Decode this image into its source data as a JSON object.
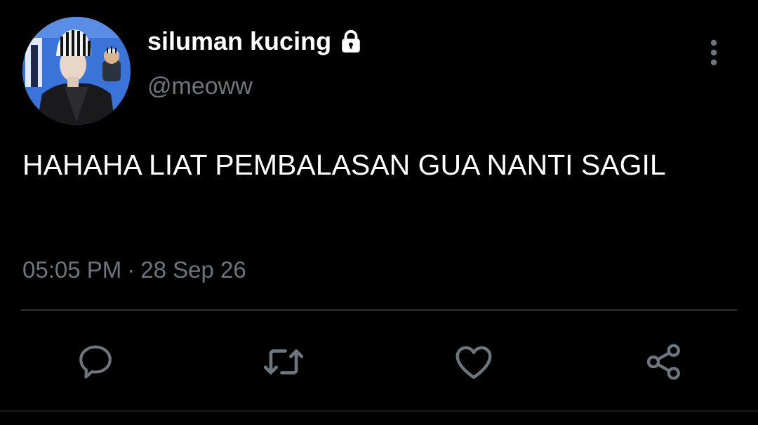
{
  "tweet": {
    "display_name": "siluman kucing",
    "protected_icon": "lock-icon",
    "handle": "@meoww",
    "text": "HAHAHA LIAT PEMBALASAN GUA NANTI SAGIL",
    "time": "05:05 PM",
    "separator": "·",
    "date": "28 Sep 26"
  },
  "actions": {
    "reply_icon": "reply-icon",
    "retweet_icon": "retweet-icon",
    "like_icon": "heart-icon",
    "share_icon": "share-icon",
    "more_icon": "more-vertical-icon"
  },
  "colors": {
    "background": "#000000",
    "primary_text": "#ffffff",
    "secondary_text": "#6e767d",
    "divider": "#2f3336"
  }
}
